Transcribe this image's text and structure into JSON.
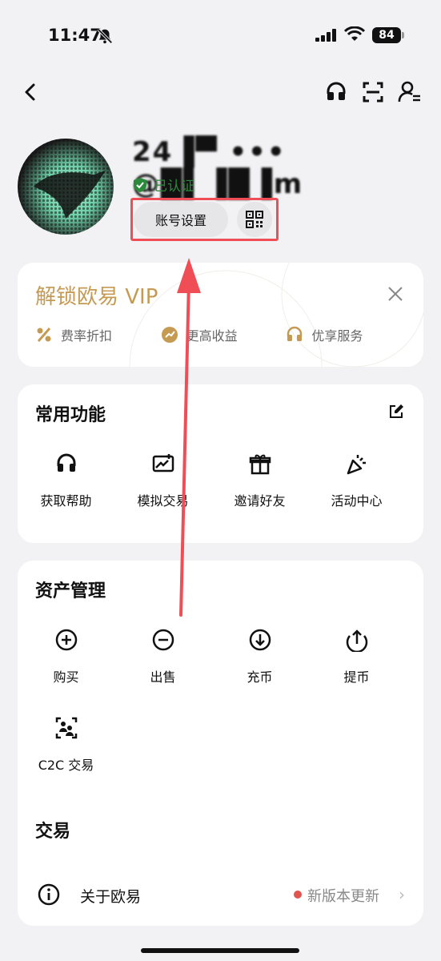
{
  "status_bar": {
    "time": "11:47",
    "battery": "84"
  },
  "profile": {
    "username": "24▐▀ ••• @█▌▐█▐m",
    "verified_label": "已认证",
    "account_settings_label": "账号设置"
  },
  "vip": {
    "title": "解锁欧易 VIP",
    "perks": [
      "费率折扣",
      "更高收益",
      "优享服务"
    ]
  },
  "common": {
    "title": "常用功能",
    "items": [
      {
        "label": "获取帮助",
        "icon": "headset-icon"
      },
      {
        "label": "模拟交易",
        "icon": "demo-trade-icon"
      },
      {
        "label": "邀请好友",
        "icon": "gift-icon"
      },
      {
        "label": "活动中心",
        "icon": "party-popper-icon"
      }
    ]
  },
  "assets": {
    "title": "资产管理",
    "items": [
      {
        "label": "购买",
        "icon": "plus-circle-icon"
      },
      {
        "label": "出售",
        "icon": "minus-circle-icon"
      },
      {
        "label": "充币",
        "icon": "deposit-icon"
      },
      {
        "label": "提币",
        "icon": "withdraw-icon"
      },
      {
        "label": "C2C 交易",
        "icon": "c2c-icon"
      }
    ]
  },
  "trade": {
    "title": "交易"
  },
  "about": {
    "label": "关于欧易",
    "update_label": "新版本更新",
    "chevron": "›"
  },
  "colors": {
    "accent_gold": "#c59b54",
    "highlight_red": "#ef4e57",
    "verified_green": "#2a8a3a"
  }
}
